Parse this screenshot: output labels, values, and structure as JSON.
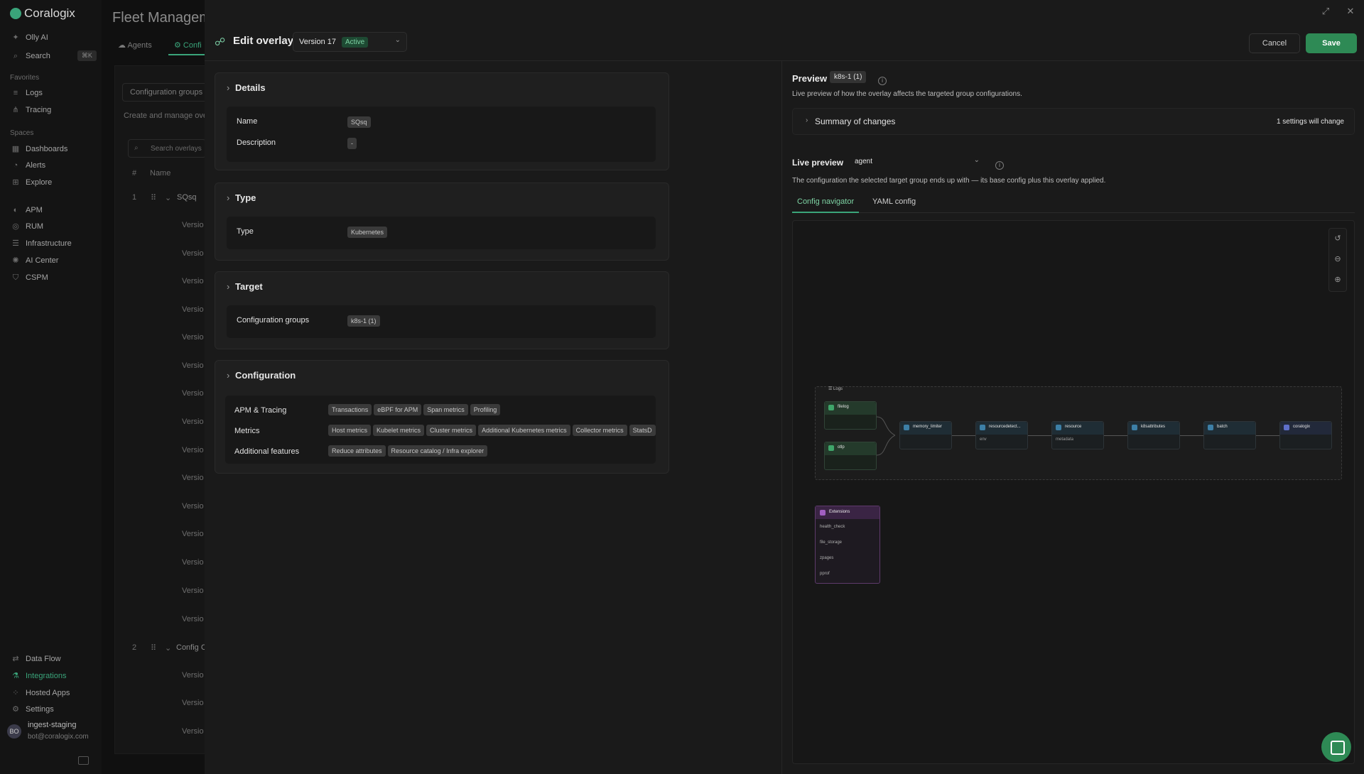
{
  "sidebar": {
    "brand": "Coralogix",
    "top_items": [
      {
        "label": "Olly AI",
        "icon": "sparkle-icon"
      },
      {
        "label": "Search",
        "icon": "search-icon",
        "shortcut": "⌘K"
      }
    ],
    "favorites_title": "Favorites",
    "favorites": [
      {
        "label": "Logs",
        "icon": "logs-icon"
      },
      {
        "label": "Tracing",
        "icon": "tracing-icon"
      }
    ],
    "spaces_title": "Spaces",
    "spaces": [
      {
        "label": "Dashboards",
        "icon": "dashboard-icon"
      },
      {
        "label": "Alerts",
        "icon": "bell-icon"
      },
      {
        "label": "Explore",
        "icon": "explore-icon"
      }
    ],
    "products": [
      {
        "label": "APM",
        "icon": "apm-icon"
      },
      {
        "label": "RUM",
        "icon": "rum-icon"
      },
      {
        "label": "Infrastructure",
        "icon": "infrastructure-icon"
      },
      {
        "label": "AI Center",
        "icon": "ai-center-icon"
      },
      {
        "label": "CSPM",
        "icon": "cspm-icon"
      }
    ],
    "bottom": [
      {
        "label": "Data Flow",
        "icon": "data-flow-icon"
      },
      {
        "label": "Integrations",
        "icon": "integrations-icon"
      },
      {
        "label": "Hosted Apps",
        "icon": "hosted-apps-icon"
      },
      {
        "label": "Settings",
        "icon": "gear-icon"
      }
    ],
    "user": {
      "initials": "BO",
      "name": "ingest-staging",
      "email": "bot@coralogix.com"
    }
  },
  "background": {
    "title": "Fleet Manageme",
    "tabs": [
      "Agents",
      "Confi"
    ],
    "chip": "Configuration groups",
    "desc": "Create and manage ove",
    "search_placeholder": "Search overlays",
    "col_hash": "#",
    "col_name": "Name",
    "rows": [
      {
        "num": "1",
        "name": "SQsq"
      },
      {
        "num": "2",
        "name": "Config C"
      }
    ],
    "version_label": "Versio"
  },
  "overlay": {
    "title": "Edit overlay",
    "version": "Version 17",
    "version_status": "Active",
    "cancel": "Cancel",
    "save": "Save",
    "details": {
      "heading": "Details",
      "name_label": "Name",
      "name_value": "SQsq",
      "description_label": "Description",
      "description_value": "-"
    },
    "type": {
      "heading": "Type",
      "label": "Type",
      "value": "Kubernetes"
    },
    "target": {
      "heading": "Target",
      "label": "Configuration groups",
      "value": "k8s-1 (1)"
    },
    "configuration": {
      "heading": "Configuration",
      "apm_label": "APM & Tracing",
      "apm_tags": [
        "Transactions",
        "eBPF for APM",
        "Span metrics",
        "Profiling"
      ],
      "metrics_label": "Metrics",
      "metrics_tags": [
        "Host metrics",
        "Kubelet metrics",
        "Cluster metrics",
        "Additional Kubernetes metrics",
        "Collector metrics",
        "StatsD"
      ],
      "features_label": "Additional features",
      "features_tags": [
        "Reduce attributes",
        "Resource catalog / Infra explorer"
      ]
    }
  },
  "preview": {
    "title": "Preview",
    "target_chip": "k8s-1 (1)",
    "subtitle": "Live preview of how the overlay affects the targeted group configurations.",
    "summary_title": "Summary of changes",
    "summary_count": "1 settings will change",
    "live_title": "Live preview",
    "live_select": "agent",
    "live_sub": "The configuration the selected target group ends up with — its base config plus this overlay applied.",
    "tabs": [
      "Config navigator",
      "YAML config"
    ],
    "pipeline_label": "Logs",
    "receivers": [
      {
        "name": "filelog",
        "detail": ""
      },
      {
        "name": "otlp",
        "detail": ""
      }
    ],
    "processors": [
      {
        "name": "memory_limiter",
        "detail": ""
      },
      {
        "name": "resourcedetect...",
        "detail": "env"
      },
      {
        "name": "resource",
        "detail": "metadata"
      },
      {
        "name": "k8sattributes",
        "detail": ""
      },
      {
        "name": "batch",
        "detail": ""
      }
    ],
    "exporter": {
      "name": "coralogix",
      "detail": ""
    },
    "extensions": {
      "title": "Extensions",
      "items": [
        "health_check",
        "file_storage",
        "zpages",
        "pprof"
      ]
    }
  },
  "colors": {
    "accent": "#2e8a55",
    "active_badge": "#7ed3a4"
  }
}
